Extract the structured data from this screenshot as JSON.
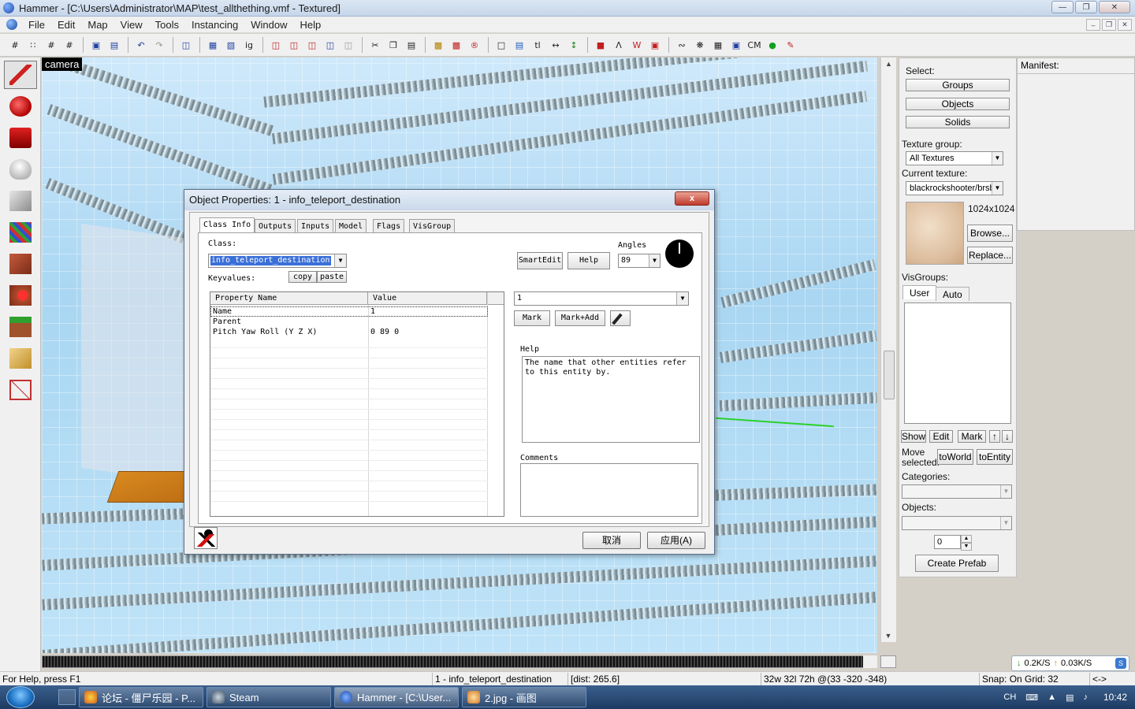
{
  "window": {
    "title": "Hammer - [C:\\Users\\Administrator\\MAP\\test_allthething.vmf - Textured]",
    "controls": [
      "minimize",
      "maximize",
      "close"
    ]
  },
  "menu": [
    "File",
    "Edit",
    "Map",
    "View",
    "Tools",
    "Instancing",
    "Window",
    "Help"
  ],
  "toolbar": {
    "cm_label": "CM",
    "tl_label": "tl",
    "ig_label": "ig"
  },
  "viewport": {
    "camera_label": "camera"
  },
  "right_panel": {
    "select_label": "Select:",
    "groups_button": "Groups",
    "objects_button": "Objects",
    "solids_button": "Solids",
    "texture_group_label": "Texture group:",
    "texture_group_value": "All Textures",
    "current_texture_label": "Current texture:",
    "current_texture_value": "blackrockshooter/brsbc",
    "texture_size": "1024x1024",
    "browse_button": "Browse...",
    "replace_button": "Replace...",
    "visgroups_label": "VisGroups:",
    "tab_user": "User",
    "tab_auto": "Auto",
    "show_button": "Show",
    "edit_button": "Edit",
    "mark_button": "Mark",
    "move_selected_label_1": "Move",
    "move_selected_label_2": "selected:",
    "to_world_button": "toWorld",
    "to_entity_button": "toEntity",
    "categories_label": "Categories:",
    "objects_label": "Objects:",
    "spin_value": "0",
    "create_prefab_button": "Create Prefab"
  },
  "manifest": {
    "label": "Manifest:"
  },
  "dialog": {
    "title": "Object Properties: 1 - info_teleport_destination",
    "close_label": "x",
    "tabs": [
      "Class Info",
      "Outputs",
      "Inputs",
      "Model",
      "Flags",
      "VisGroup"
    ],
    "class_label": "Class:",
    "class_value": "info_teleport_destination",
    "keyvalues_label": "Keyvalues:",
    "copy_button": "copy",
    "paste_button": "paste",
    "smartedit_button": "SmartEdit",
    "help_button": "Help",
    "angles_label": "Angles",
    "angles_value": "89",
    "table_headers": [
      "Property Name",
      "Value"
    ],
    "rows": [
      {
        "key": "Name",
        "value": "1"
      },
      {
        "key": "Parent",
        "value": ""
      },
      {
        "key": "Pitch Yaw Roll (Y Z X)",
        "value": "0 89 0"
      }
    ],
    "value_field": "1",
    "mark_button": "Mark",
    "mark_add_button": "Mark+Add",
    "help_label": "Help",
    "help_text": "The name that other entities refer to this entity by.",
    "comments_label": "Comments",
    "cancel_button": "取消",
    "apply_button": "应用(A)"
  },
  "status_bar": {
    "help": "For Help, press F1",
    "selection": "1 - info_teleport_destination",
    "dist": "[dist: 265.6]",
    "coords": "32w 32l 72h @(33 -320 -348)",
    "snap": "Snap: On Grid: 32",
    "arrows": "<->"
  },
  "network": {
    "down": "0.2K/S",
    "up": "0.03K/S"
  },
  "taskbar": {
    "items": [
      {
        "label": "论坛 - 僵尸乐园 - P...",
        "color": "#e0a020"
      },
      {
        "label": "Steam",
        "color": "#5a6f8a"
      },
      {
        "label": "Hammer - [C:\\User...",
        "color": "#2b5fb3"
      },
      {
        "label": "2.jpg - 画图",
        "color": "#d07a2a"
      }
    ],
    "tray_lang": "CH",
    "clock": "10:42"
  },
  "colors": {
    "accent": "#3a6fd8",
    "sky": "#a9d6f2",
    "floor": "#d9891f"
  }
}
